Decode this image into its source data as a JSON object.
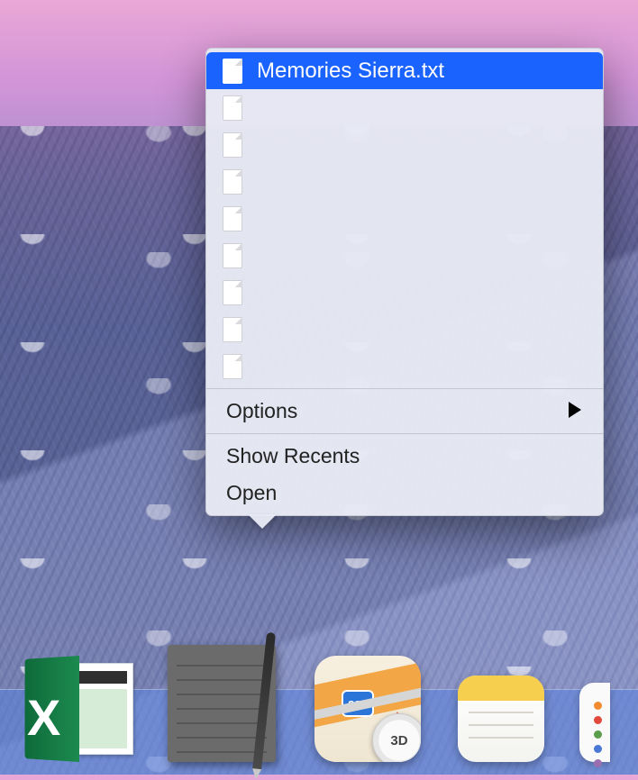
{
  "context_menu": {
    "recents": [
      {
        "label": "Memories Sierra.txt",
        "selected": true
      },
      {
        "label": "",
        "selected": false
      },
      {
        "label": "",
        "selected": false
      },
      {
        "label": "",
        "selected": false
      },
      {
        "label": "",
        "selected": false
      },
      {
        "label": "",
        "selected": false
      },
      {
        "label": "",
        "selected": false
      },
      {
        "label": "",
        "selected": false
      },
      {
        "label": "",
        "selected": false
      }
    ],
    "options_label": "Options",
    "show_recents_label": "Show Recents",
    "open_label": "Open"
  },
  "dock": {
    "excel_letter": "X",
    "maps_sign": "280",
    "maps_compass": "3D",
    "reminder_colors": [
      "#f28b30",
      "#e2493d",
      "#5a9e4b",
      "#4a78d6",
      "#9a6fb0"
    ]
  }
}
